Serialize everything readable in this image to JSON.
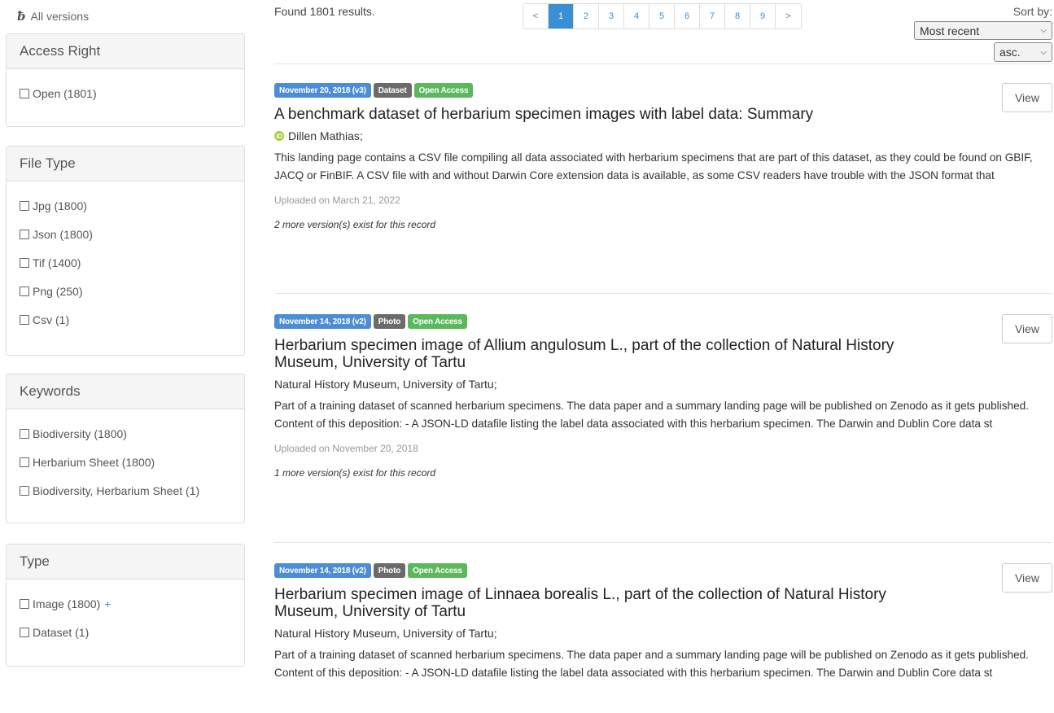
{
  "sidebar": {
    "all_versions": "All versions",
    "panels": [
      {
        "title": "Access Right",
        "items": [
          {
            "label": "Open (1801)"
          }
        ]
      },
      {
        "title": "File Type",
        "items": [
          {
            "label": "Jpg (1800)"
          },
          {
            "label": "Json (1800)"
          },
          {
            "label": "Tif (1400)"
          },
          {
            "label": "Png (250)"
          },
          {
            "label": "Csv (1)"
          }
        ]
      },
      {
        "title": "Keywords",
        "items": [
          {
            "label": "Biodiversity (1800)"
          },
          {
            "label": "Herbarium Sheet (1800)"
          },
          {
            "label": "Biodiversity, Herbarium Sheet (1)"
          }
        ]
      },
      {
        "title": "Type",
        "items": [
          {
            "label": "Image (1800)",
            "expand": "+"
          },
          {
            "label": "Dataset (1)"
          }
        ]
      }
    ]
  },
  "results": {
    "found_text": "Found 1801 results.",
    "pagination": {
      "prev": "<",
      "next": ">",
      "pages": [
        "1",
        "2",
        "3",
        "4",
        "5",
        "6",
        "7",
        "8",
        "9"
      ],
      "current_page": "1"
    },
    "sort": {
      "label": "Sort by:",
      "order_value": "Most recent",
      "direction_value": "asc."
    }
  },
  "records": [
    {
      "date_label": "November 20, 2018 (v3)",
      "type_label": "Dataset",
      "access_label": "Open Access",
      "title": "A benchmark dataset of herbarium specimen images with label data: Summary",
      "creators": "Dillen Mathias;",
      "has_orcid": true,
      "description": "This landing page contains a CSV file compiling all data associated with herbarium specimens that are part of this dataset, as they could be found on GBIF, JACQ or FinBIF. A CSV file with and without Darwin Core extension data is available, as some CSV readers have trouble with the JSON format that",
      "uploaded": "Uploaded on March 21, 2022",
      "versions_note": "2 more version(s) exist for this record",
      "view_label": "View"
    },
    {
      "date_label": "November 14, 2018 (v2)",
      "type_label": "Photo",
      "access_label": "Open Access",
      "title": "Herbarium specimen image of Allium angulosum L., part of the collection of Natural History Museum, University of Tartu",
      "creators": "Natural History Museum, University of Tartu;",
      "has_orcid": false,
      "description": "Part of a training dataset of scanned herbarium specimens. The data paper and a summary landing page will be published on Zenodo as it gets published. Content of this deposition: - A JSON-LD datafile listing the label data associated with this herbarium specimen. The Darwin and Dublin Core data st",
      "uploaded": "Uploaded on November 20, 2018",
      "versions_note": "1 more version(s) exist for this record",
      "view_label": "View"
    },
    {
      "date_label": "November 14, 2018 (v2)",
      "type_label": "Photo",
      "access_label": "Open Access",
      "title": "Herbarium specimen image of Linnaea borealis L., part of the collection of Natural History Museum, University of Tartu",
      "creators": "Natural History Museum, University of Tartu;",
      "has_orcid": false,
      "description": "Part of a training dataset of scanned herbarium specimens. The data paper and a summary landing page will be published on Zenodo as it gets published. Content of this deposition: - A JSON-LD datafile listing the label data associated with this herbarium specimen. The Darwin and Dublin Core data st",
      "view_label": "View"
    }
  ],
  "icons": {
    "all_versions": "branch-icon",
    "orcid": "orcid-icon",
    "checkbox": "checkbox-icon",
    "select_arrow": "chevron-down-icon"
  },
  "colors": {
    "accent": "#3a8fd4",
    "date_label": "#4c8dd6",
    "type_label": "#6b6b6b",
    "access_label": "#5cb85c",
    "orcid": "#a6ce39"
  }
}
